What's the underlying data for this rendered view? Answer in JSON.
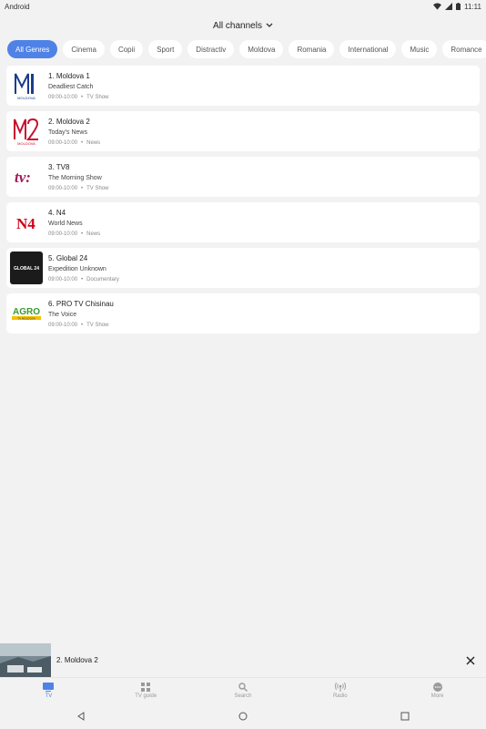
{
  "status": {
    "left": "Android",
    "time": "11:11"
  },
  "header": {
    "title": "All channels"
  },
  "genres": [
    "All Genres",
    "Cinema",
    "Copii",
    "Sport",
    "Distractiv",
    "Moldova",
    "Romania",
    "International",
    "Music",
    "Romance"
  ],
  "channels": [
    {
      "name": "1. Moldova 1",
      "program": "Deadliest Catch",
      "time": "09:00-10:00",
      "category": "TV Show",
      "logo": "moldova-1-logo"
    },
    {
      "name": "2. Moldova 2",
      "program": "Today's News",
      "time": "09:00-10:00",
      "category": "News",
      "logo": "moldova-2-logo"
    },
    {
      "name": "3. TV8",
      "program": "The Morning Show",
      "time": "09:00-10:00",
      "category": "TV Show",
      "logo": "tv8-logo"
    },
    {
      "name": "4. N4",
      "program": "World News",
      "time": "09:00-10:00",
      "category": "News",
      "logo": "n4-logo"
    },
    {
      "name": "5. Global 24",
      "program": "Expedition Unknown",
      "time": "09:00-10:00",
      "category": "Documentary",
      "logo": "global24-logo"
    },
    {
      "name": "6. PRO TV Chisinau",
      "program": "The Voice",
      "time": "09:00-10:00",
      "category": "TV Show",
      "logo": "agro-logo"
    }
  ],
  "logo_text": {
    "moldova_label": "MOLDOVA",
    "tv8": "tv:",
    "n4": "N4",
    "global": "GLOBAL 24",
    "agro": "AGRO",
    "agro_sub": "TV MOLDOVA"
  },
  "mini_player": {
    "title": "2. Moldova 2"
  },
  "bottom_nav": [
    {
      "label": "TV",
      "icon": "tv-icon",
      "active": true
    },
    {
      "label": "TV guide",
      "icon": "grid-icon",
      "active": false
    },
    {
      "label": "Search",
      "icon": "search-icon",
      "active": false
    },
    {
      "label": "Radio",
      "icon": "radio-icon",
      "active": false
    },
    {
      "label": "More",
      "icon": "more-icon",
      "active": false
    }
  ],
  "colors": {
    "accent": "#4f82e6",
    "background": "#f2f2f2",
    "card": "#ffffff"
  }
}
